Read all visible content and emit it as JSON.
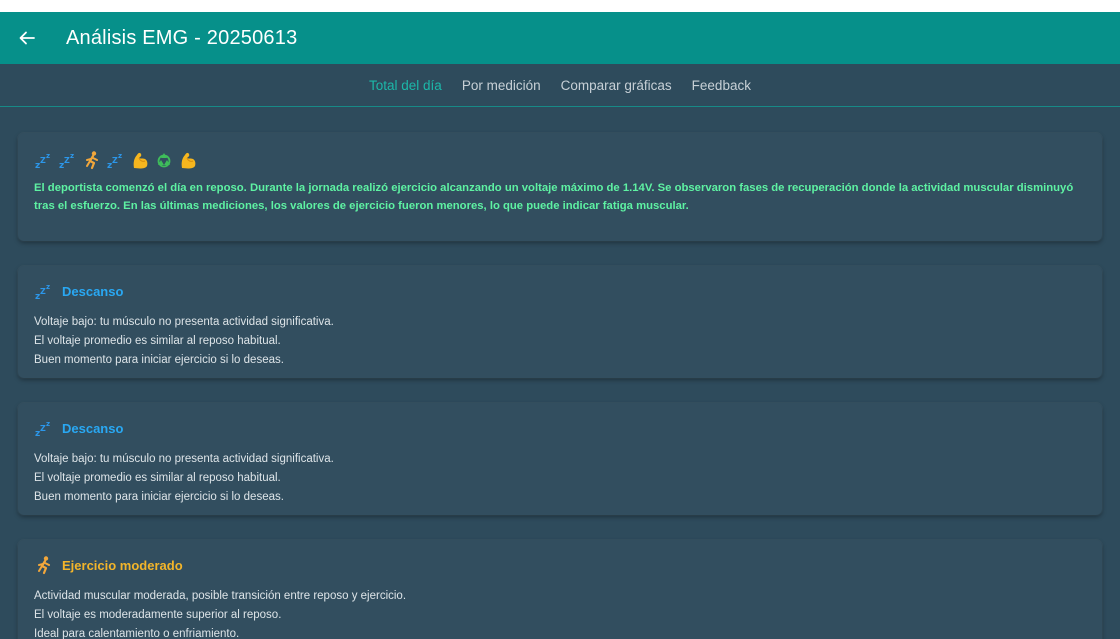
{
  "appbar": {
    "title": "Análisis EMG - 20250613",
    "back_icon": "arrow-left-icon"
  },
  "tabs": [
    {
      "label": "Total del día",
      "active": true
    },
    {
      "label": "Por medición",
      "active": false
    },
    {
      "label": "Comparar gráficas",
      "active": false
    },
    {
      "label": "Feedback",
      "active": false
    }
  ],
  "summary": {
    "emoji_sequence": [
      "sleep-icon",
      "sleep-icon",
      "runner-icon",
      "sleep-icon",
      "flexed-biceps-icon",
      "recycle-icon",
      "flexed-biceps-icon"
    ],
    "text": "El deportista comenzó el día en reposo. Durante la jornada realizó ejercicio alcanzando un voltaje máximo de 1.14V. Se observaron fases de recuperación donde la actividad muscular disminuyó tras el esfuerzo. En las últimas mediciones, los valores de ejercicio fueron menores, lo que puede indicar fatiga muscular."
  },
  "states": [
    {
      "icon": "sleep-icon",
      "title": "Descanso",
      "lines": [
        "Voltaje bajo: tu músculo no presenta actividad significativa.",
        "El voltaje promedio es similar al reposo habitual.",
        "Buen momento para iniciar ejercicio si lo deseas."
      ]
    },
    {
      "icon": "sleep-icon",
      "title": "Descanso",
      "lines": [
        "Voltaje bajo: tu músculo no presenta actividad significativa.",
        "El voltaje promedio es similar al reposo habitual.",
        "Buen momento para iniciar ejercicio si lo deseas."
      ]
    },
    {
      "icon": "runner-icon",
      "title": "Ejercicio moderado",
      "lines": [
        "Actividad muscular moderada, posible transición entre reposo y ejercicio.",
        "El voltaje es moderadamente superior al reposo.",
        "Ideal para calentamiento o enfriamiento."
      ]
    }
  ],
  "colors": {
    "appbar": "#06908a",
    "background": "#2e4b5c",
    "active_tab": "#1cb8a9",
    "summary_text": "#5ef2a3",
    "rest_title": "#29a8f3",
    "moderate_title": "#f3b52a"
  }
}
